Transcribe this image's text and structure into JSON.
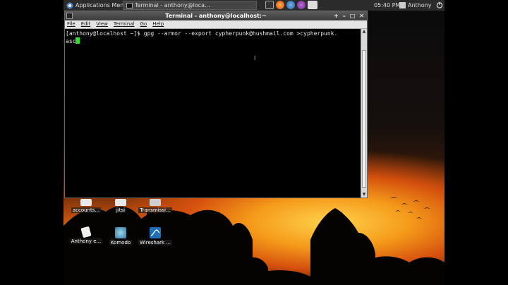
{
  "panel": {
    "applications_menu": "Applications Menu",
    "task_title": "Terminal - anthony@loca...",
    "clock": "05:40 PM",
    "user": "Anthony"
  },
  "terminal": {
    "title": "Terminal - anthony@localhost:~",
    "menu": [
      "File",
      "Edit",
      "View",
      "Terminal",
      "Go",
      "Help"
    ],
    "line1": "[anthony@localhost ~]$ gpg --armor --export cypherpunk@hushmail.com >cypherpunk.",
    "line2": "asc"
  },
  "desktop_icons": [
    {
      "label": "accounts..."
    },
    {
      "label": "jitsi"
    },
    {
      "label": "Transmissi..."
    },
    {
      "label": "Anthony e..."
    },
    {
      "label": "Komodo"
    },
    {
      "label": "Wireshark ..."
    }
  ],
  "colors": {
    "panel_bg": "#2b2b2b",
    "cursor": "#2fe02f",
    "sunset": "#ef8a1a"
  }
}
